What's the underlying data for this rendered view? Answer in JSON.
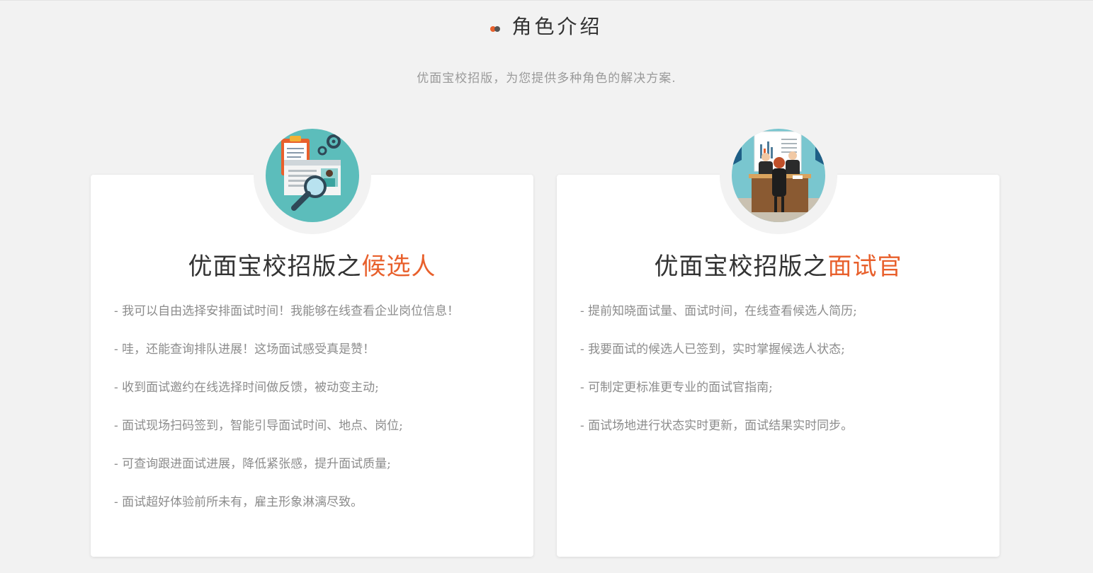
{
  "colors": {
    "accent": "#e8602c",
    "dot_primary": "#e8602c",
    "dot_secondary": "#555555",
    "background": "#f2f2f2",
    "card": "#ffffff"
  },
  "section": {
    "title": "角色介绍",
    "subtitle": "优面宝校招版，为您提供多种角色的解决方案."
  },
  "cards": [
    {
      "illustration_icon": "resume-search-illustration",
      "title_prefix": "优面宝校招版之",
      "title_accent": "候选人",
      "items": [
        "- 我可以自由选择安排面试时间！我能够在线查看企业岗位信息！",
        "- 哇，还能查询排队进展！这场面试感受真是赞！",
        "- 收到面试邀约在线选择时间做反馈，被动变主动;",
        "- 面试现场扫码签到，智能引导面试时间、地点、岗位;",
        "- 可查询跟进面试进展，降低紧张感，提升面试质量;",
        "- 面试超好体验前所未有，雇主形象淋漓尽致。"
      ]
    },
    {
      "illustration_icon": "interview-panel-illustration",
      "title_prefix": "优面宝校招版之",
      "title_accent": "面试官",
      "items": [
        "- 提前知晓面试量、面试时间，在线查看候选人简历;",
        "- 我要面试的候选人已签到，实时掌握候选人状态;",
        "- 可制定更标准更专业的面试官指南;",
        "- 面试场地进行状态实时更新，面试结果实时同步。"
      ]
    }
  ]
}
